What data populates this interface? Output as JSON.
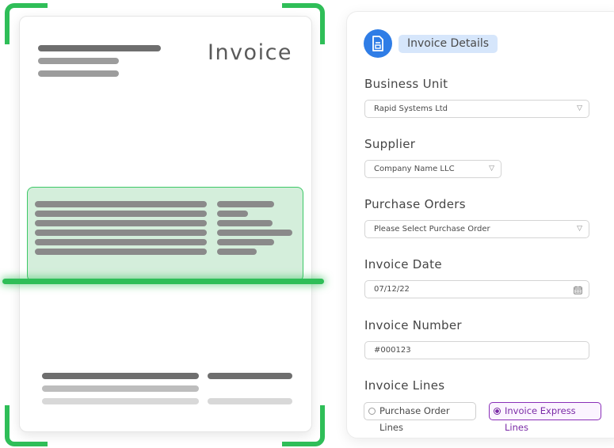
{
  "colors": {
    "scan_green": "#2fbe58",
    "accent_blue": "#2f7de6",
    "selected_purple": "#7a2aa6"
  },
  "document": {
    "title": "Invoice"
  },
  "form": {
    "header": {
      "icon": "document-icon",
      "label": "Invoice Details"
    },
    "business_unit": {
      "label": "Business Unit",
      "value": "Rapid Systems Ltd",
      "icon": "chevron-down-icon"
    },
    "supplier": {
      "label": "Supplier",
      "value": "Company Name LLC",
      "icon": "chevron-down-icon"
    },
    "purchase_orders": {
      "label": "Purchase Orders",
      "placeholder": "Please Select Purchase Order",
      "icon": "chevron-down-icon"
    },
    "invoice_date": {
      "label": "Invoice Date",
      "value": "07/12/22",
      "icon": "calendar-icon"
    },
    "invoice_number": {
      "label": "Invoice Number",
      "value": "#000123"
    },
    "invoice_lines": {
      "label": "Invoice Lines",
      "options": [
        {
          "label": "Purchase Order Lines",
          "selected": false
        },
        {
          "label": "Invoice Express Lines",
          "selected": true
        }
      ]
    }
  }
}
